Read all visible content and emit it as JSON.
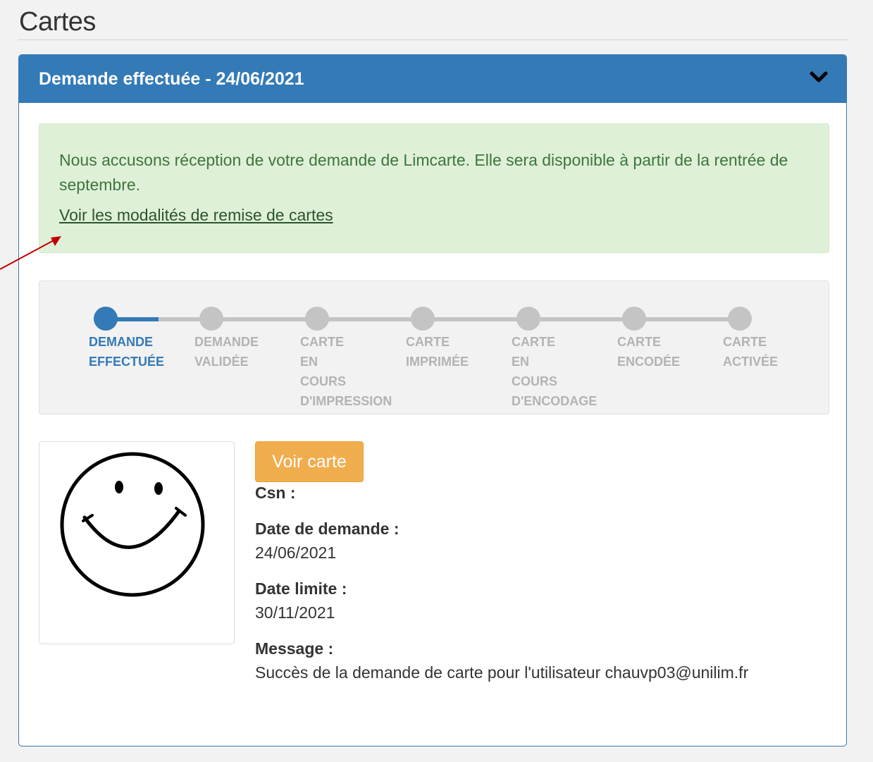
{
  "page": {
    "title": "Cartes"
  },
  "panel": {
    "title": "Demande effectuée - 24/06/2021",
    "toggle_icon": "chevron-down-icon"
  },
  "alert": {
    "message": "Nous accusons réception de votre demande de Limcarte. Elle sera disponible à partir de la rentrée de septembre.",
    "link": "Voir les modalités de remise de cartes"
  },
  "steps": [
    {
      "label": "DEMANDE\nEFFECTUÉE",
      "active": true
    },
    {
      "label": "DEMANDE\nVALIDÉE",
      "active": false
    },
    {
      "label": "CARTE\nEN\nCOURS\nD'IMPRESSION",
      "active": false
    },
    {
      "label": "CARTE\nIMPRIMÉE",
      "active": false
    },
    {
      "label": "CARTE\nEN\nCOURS\nD'ENCODAGE",
      "active": false
    },
    {
      "label": "CARTE\nENCODÉE",
      "active": false
    },
    {
      "label": "CARTE\nACTIVÉE",
      "active": false
    }
  ],
  "card": {
    "photo_icon": "smiley-face-icon",
    "voir_button": "Voir carte",
    "csn_label": "Csn :",
    "date_demande_label": "Date de demande :",
    "date_demande": "24/06/2021",
    "date_limite_label": "Date limite :",
    "date_limite": "30/11/2021",
    "message_label": "Message :",
    "message": "Succès de la demande de carte pour l'utilisateur chauvp03@unilim.fr"
  },
  "colors": {
    "primary": "#337ab7",
    "success_bg": "#dff0d8",
    "success_text": "#3c763d",
    "warning": "#f0ad4e",
    "step_inactive": "#c4c4c4",
    "annotation_arrow": "#c00000"
  }
}
